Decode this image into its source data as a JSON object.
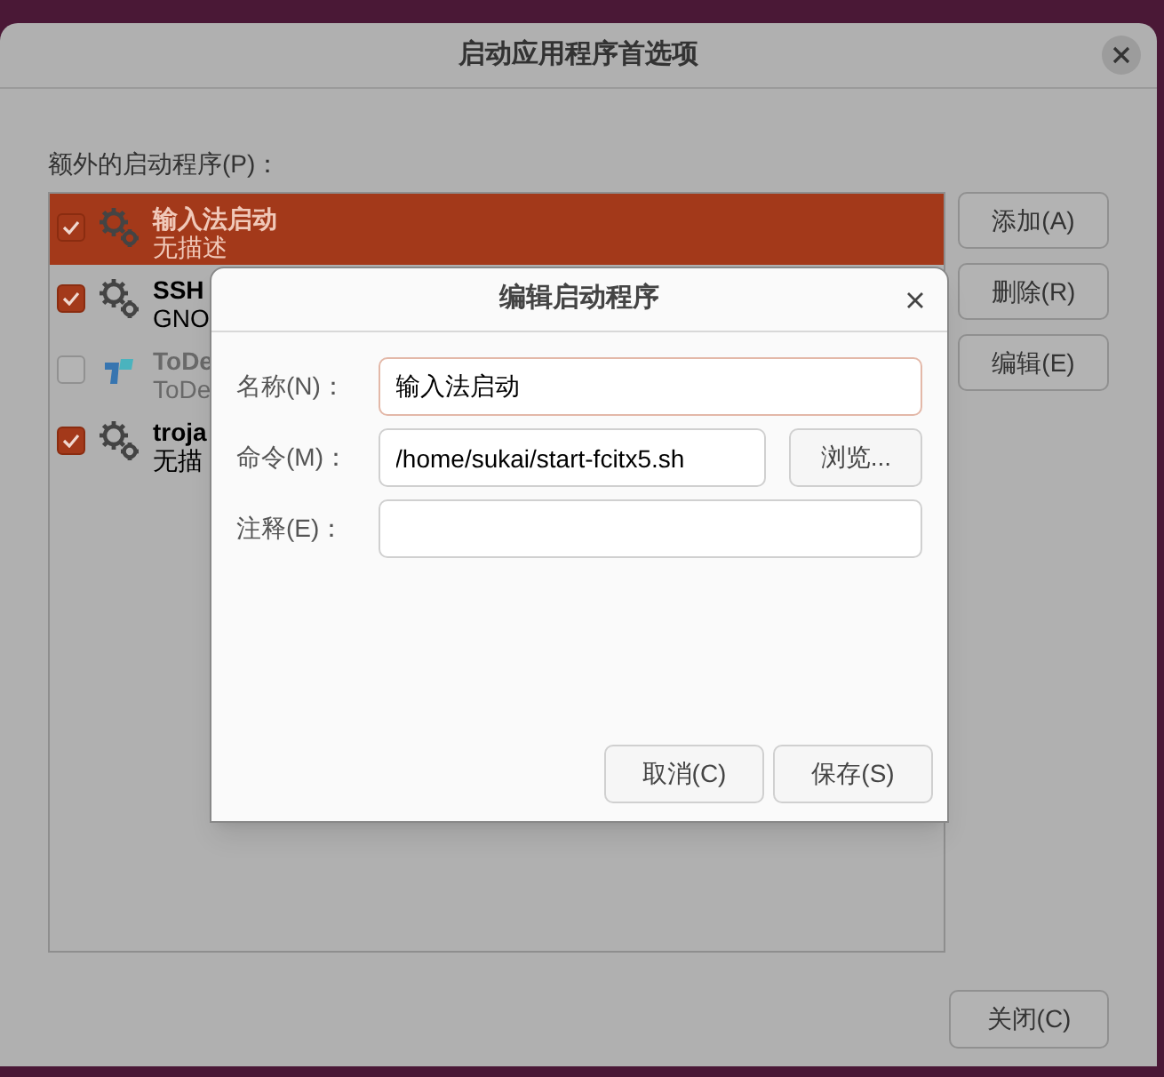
{
  "window": {
    "title": "启动应用程序首选项"
  },
  "list_label": "额外的启动程序(P)：",
  "programs": [
    {
      "name": "输入法启动",
      "description": "无描述",
      "checked": true,
      "selected": true,
      "disabled": false,
      "kind": "gears"
    },
    {
      "name": "SSH",
      "description": "GNO",
      "checked": true,
      "selected": false,
      "disabled": false,
      "kind": "gears"
    },
    {
      "name": "ToDe",
      "description": "ToDe",
      "checked": false,
      "selected": false,
      "disabled": true,
      "kind": "todesk"
    },
    {
      "name": "troja",
      "description": "无描",
      "checked": true,
      "selected": false,
      "disabled": false,
      "kind": "gears"
    }
  ],
  "side_buttons": [
    "添加(A)",
    "删除(R)",
    "编辑(E)"
  ],
  "close_button": "关闭(C)",
  "dialog": {
    "title": "编辑启动程序",
    "fields": [
      {
        "label": "名称(N)：",
        "value": "输入法启动",
        "focused": true
      },
      {
        "label": "命令(M)：",
        "value": "/home/sukai/start-fcitx5.sh",
        "focused": false,
        "button": "浏览..."
      },
      {
        "label": "注释(E)：",
        "focused": false
      }
    ],
    "buttons": [
      "取消(C)",
      "保存(S)"
    ]
  }
}
